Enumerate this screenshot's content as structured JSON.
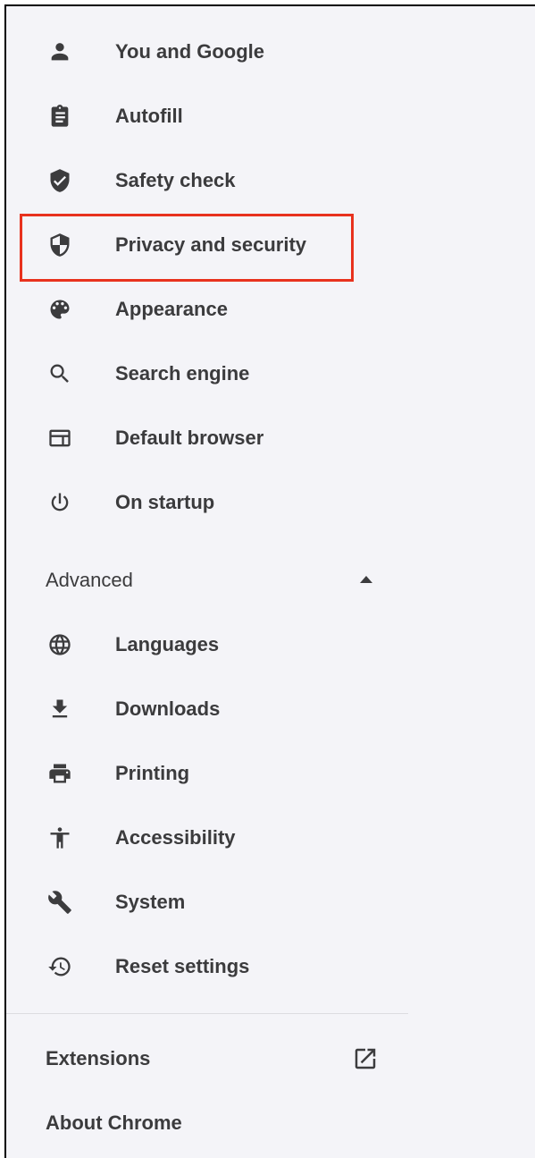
{
  "nav": {
    "items": [
      {
        "label": "You and Google",
        "icon": "person-icon"
      },
      {
        "label": "Autofill",
        "icon": "clipboard-icon"
      },
      {
        "label": "Safety check",
        "icon": "shield-check-icon"
      },
      {
        "label": "Privacy and security",
        "icon": "shield-half-icon",
        "highlighted": true
      },
      {
        "label": "Appearance",
        "icon": "palette-icon"
      },
      {
        "label": "Search engine",
        "icon": "search-icon"
      },
      {
        "label": "Default browser",
        "icon": "browser-window-icon"
      },
      {
        "label": "On startup",
        "icon": "power-icon"
      }
    ]
  },
  "advanced": {
    "label": "Advanced",
    "expanded": true,
    "items": [
      {
        "label": "Languages",
        "icon": "globe-icon"
      },
      {
        "label": "Downloads",
        "icon": "download-icon"
      },
      {
        "label": "Printing",
        "icon": "printer-icon"
      },
      {
        "label": "Accessibility",
        "icon": "accessibility-icon"
      },
      {
        "label": "System",
        "icon": "wrench-icon"
      },
      {
        "label": "Reset settings",
        "icon": "history-icon"
      }
    ]
  },
  "footer": {
    "extensions_label": "Extensions",
    "extensions_icon": "open-in-new-icon",
    "about_label": "About Chrome"
  },
  "colors": {
    "highlight": "#e8321e",
    "panel_bg": "#f4f4f8",
    "text": "#3b3b3d"
  }
}
